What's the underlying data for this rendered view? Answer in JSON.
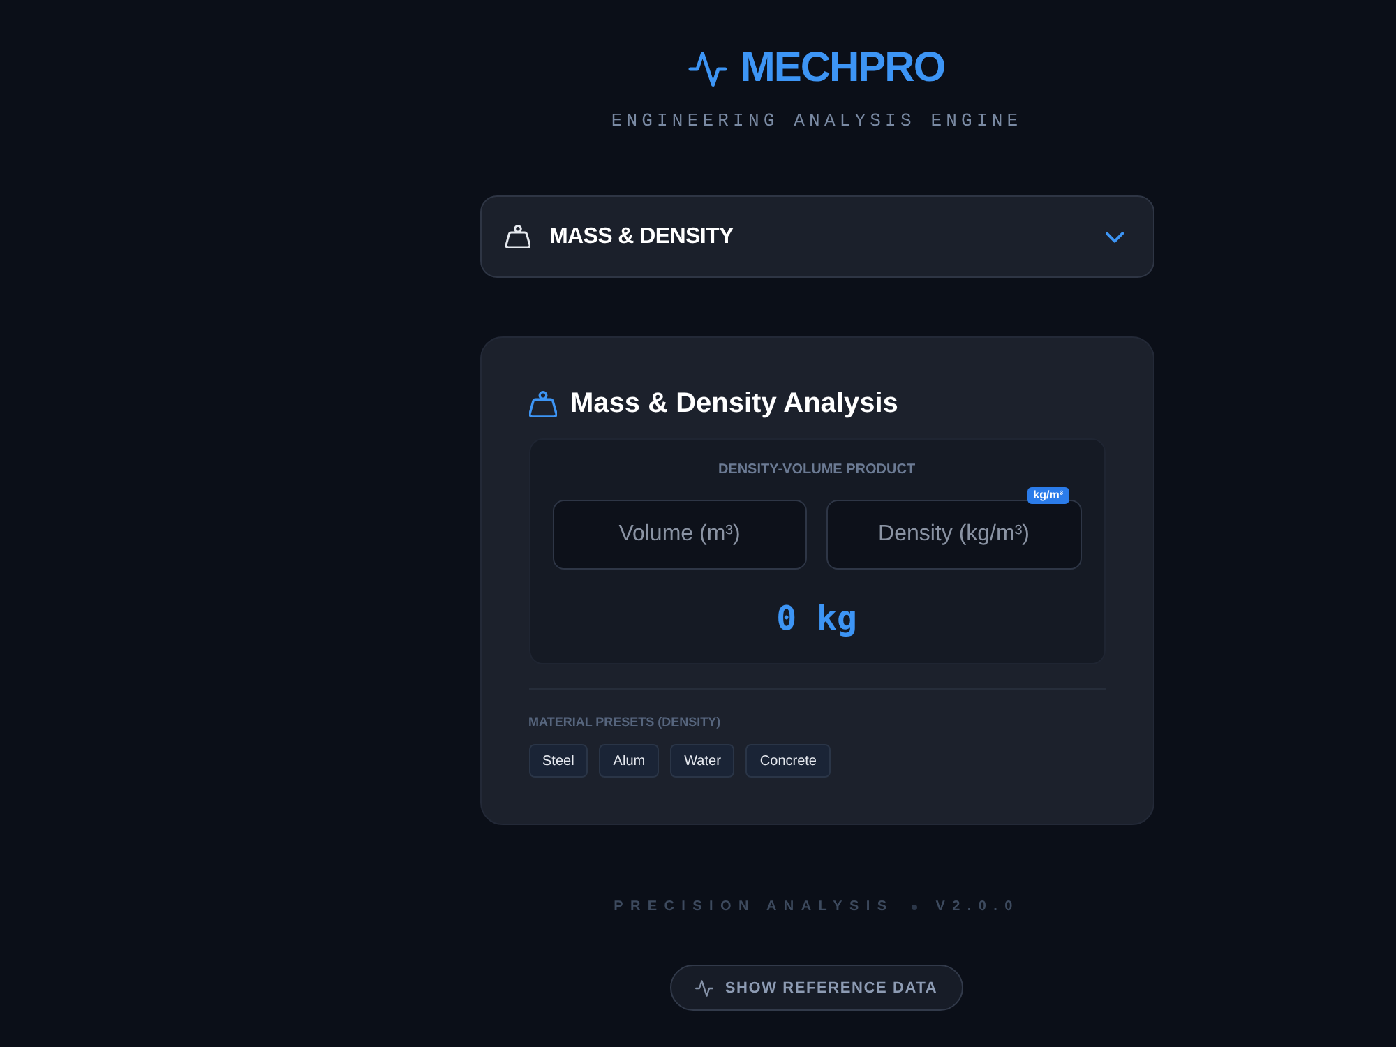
{
  "header": {
    "title": "MECHPRO",
    "subtitle": "ENGINEERING ANALYSIS ENGINE"
  },
  "module_select": {
    "value": "MASS & DENSITY"
  },
  "card": {
    "title": "Mass & Density Analysis",
    "calculator": {
      "label": "DENSITY-VOLUME PRODUCT",
      "fields": [
        {
          "placeholder": "Volume (m³)"
        },
        {
          "placeholder": "Density (kg/m³)",
          "badge": "kg/m³"
        }
      ],
      "result": "0 kg"
    },
    "presets": {
      "label": "MATERIAL PRESETS (DENSITY)",
      "items": [
        "Steel",
        "Alum",
        "Water",
        "Concrete"
      ]
    }
  },
  "footer": {
    "items": [
      "PRECISION ANALYSIS",
      "V2.0.0"
    ]
  },
  "reference_button": {
    "label": "SHOW REFERENCE DATA"
  }
}
